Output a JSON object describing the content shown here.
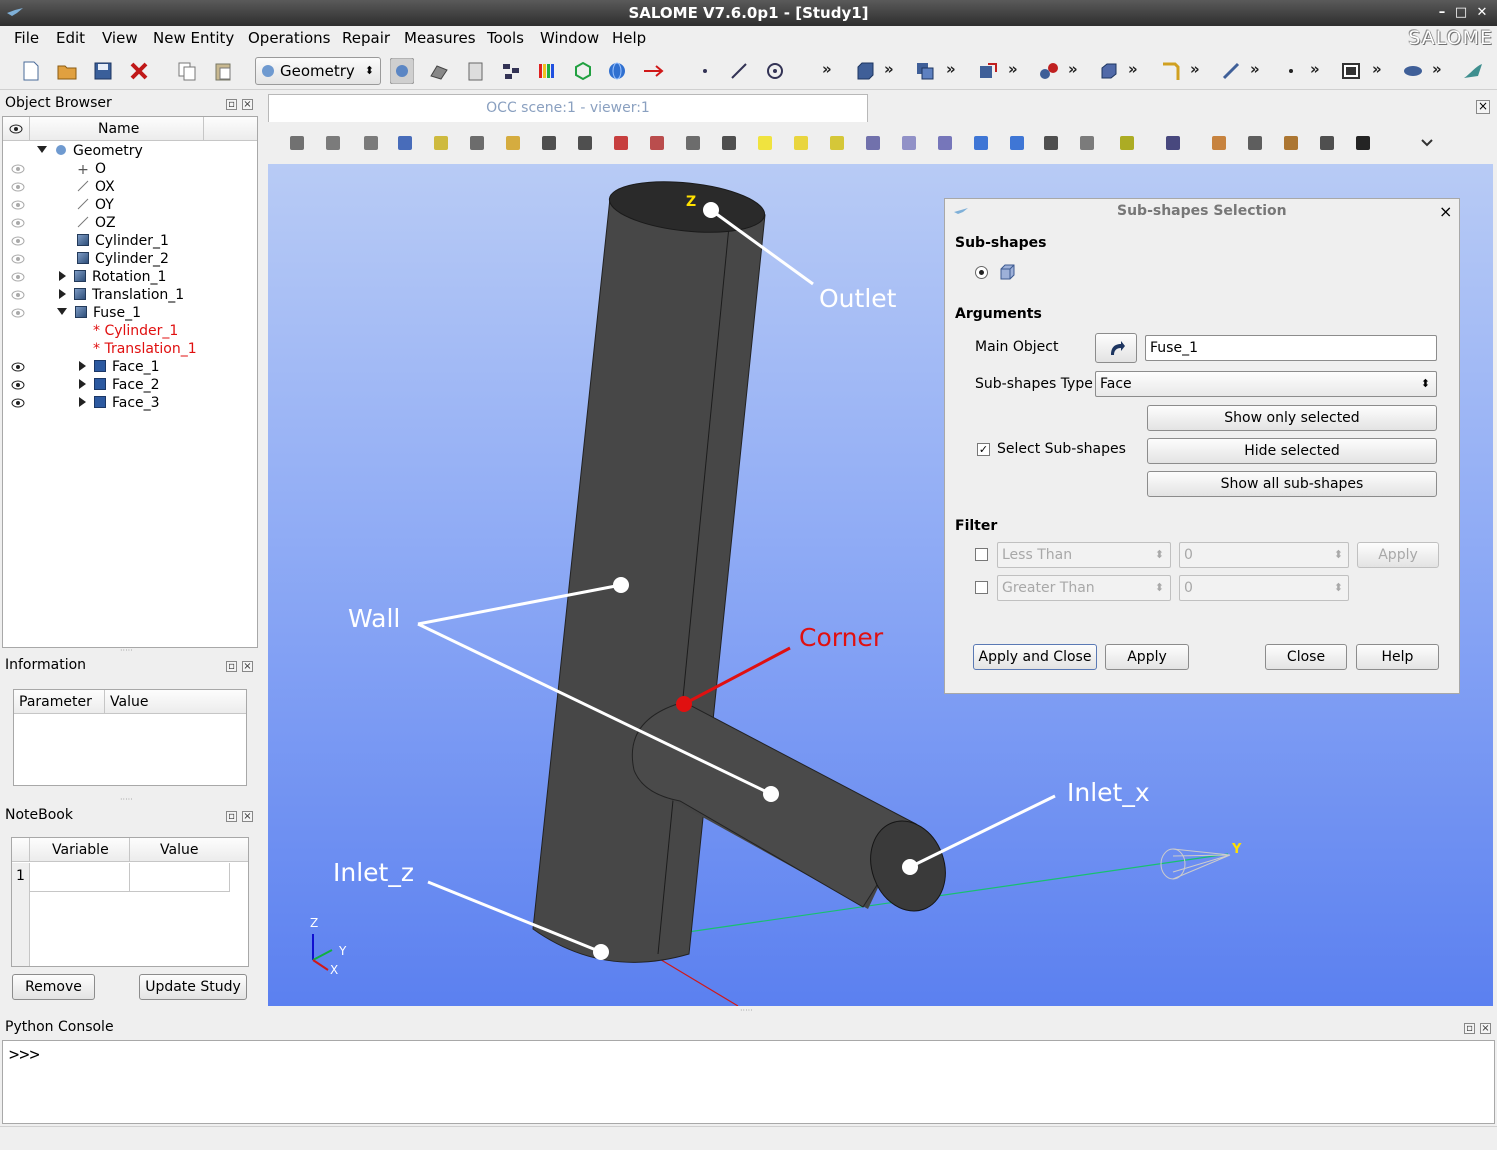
{
  "window": {
    "title": "SALOME  V7.6.0p1 - [Study1]",
    "logo": "SALOME"
  },
  "menu": [
    "File",
    "Edit",
    "View",
    "New Entity",
    "Operations",
    "Repair",
    "Measures",
    "Tools",
    "Window",
    "Help"
  ],
  "toolbar": {
    "module": "Geometry"
  },
  "object_browser": {
    "title": "Object Browser",
    "column": "Name",
    "items": [
      {
        "label": "Geometry"
      },
      {
        "label": "O"
      },
      {
        "label": "OX"
      },
      {
        "label": "OY"
      },
      {
        "label": "OZ"
      },
      {
        "label": "Cylinder_1"
      },
      {
        "label": "Cylinder_2"
      },
      {
        "label": "Rotation_1"
      },
      {
        "label": "Translation_1"
      },
      {
        "label": "Fuse_1"
      },
      {
        "label": "* Cylinder_1"
      },
      {
        "label": "* Translation_1"
      },
      {
        "label": "Face_1"
      },
      {
        "label": "Face_2"
      },
      {
        "label": "Face_3"
      }
    ]
  },
  "information": {
    "title": "Information",
    "col_parameter": "Parameter",
    "col_value": "Value"
  },
  "notebook": {
    "title": "NoteBook",
    "col_variable": "Variable",
    "col_value": "Value",
    "row_number": "1",
    "remove": "Remove",
    "update": "Update Study"
  },
  "viewer": {
    "tab": "OCC scene:1 - viewer:1",
    "labels": {
      "outlet": "Outlet",
      "wall": "Wall",
      "corner": "Corner",
      "inlet_x": "Inlet_x",
      "inlet_z": "Inlet_z",
      "axis_z": "Z",
      "axis_y": "Y",
      "triad_z": "Z",
      "triad_y": "Y",
      "triad_x": "X"
    }
  },
  "dialog": {
    "title": "Sub-shapes Selection",
    "section_subshapes": "Sub-shapes",
    "section_arguments": "Arguments",
    "main_object_label": "Main Object",
    "main_object_value": "Fuse_1",
    "subshapes_type_label": "Sub-shapes Type",
    "subshapes_type_value": "Face",
    "show_only_selected": "Show only selected",
    "select_subshapes": "Select Sub-shapes",
    "hide_selected": "Hide selected",
    "show_all": "Show all sub-shapes",
    "section_filter": "Filter",
    "filter1_type": "Less Than",
    "filter1_value": "0",
    "filter_apply": "Apply",
    "filter2_type": "Greater Than",
    "filter2_value": "0",
    "apply_and_close": "Apply and Close",
    "apply": "Apply",
    "close": "Close",
    "help": "Help"
  },
  "python_console": {
    "title": "Python Console",
    "prompt": ">>>"
  }
}
